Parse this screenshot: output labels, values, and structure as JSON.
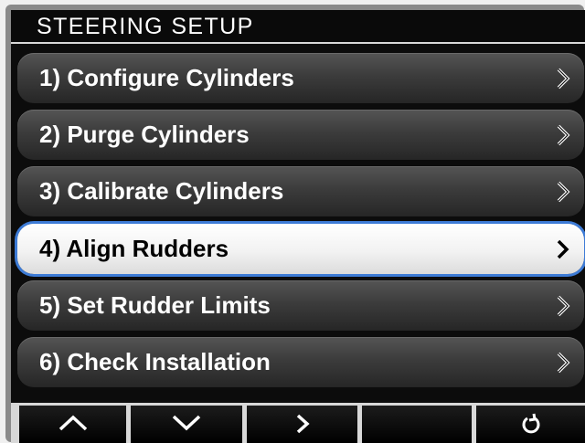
{
  "header": {
    "title": "STEERING SETUP"
  },
  "menu": {
    "selected_index": 3,
    "items": [
      {
        "label": "1) Configure Cylinders",
        "chevron_icon": "chevron-right-icon"
      },
      {
        "label": "2) Purge Cylinders",
        "chevron_icon": "chevron-right-icon"
      },
      {
        "label": "3) Calibrate Cylinders",
        "chevron_icon": "chevron-right-icon"
      },
      {
        "label": "4) Align Rudders",
        "chevron_icon": "chevron-right-icon"
      },
      {
        "label": "5) Set Rudder Limits",
        "chevron_icon": "chevron-right-icon"
      },
      {
        "label": "6) Check Installation",
        "chevron_icon": "chevron-right-icon"
      }
    ]
  },
  "softkeys": [
    {
      "icon": "chevron-up-icon"
    },
    {
      "icon": "chevron-down-icon"
    },
    {
      "icon": "chevron-right-icon"
    },
    {
      "icon": ""
    },
    {
      "icon": "back-return-icon"
    }
  ],
  "colors": {
    "screen_bg": "#0c0c0c",
    "item_gradient_top": "#555555",
    "item_gradient_bottom": "#262626",
    "selected_bg": "#ffffff",
    "selected_border": "#3d7bd6",
    "text": "#ffffff",
    "selected_text": "#000000",
    "divider": "#d8d8d8"
  }
}
